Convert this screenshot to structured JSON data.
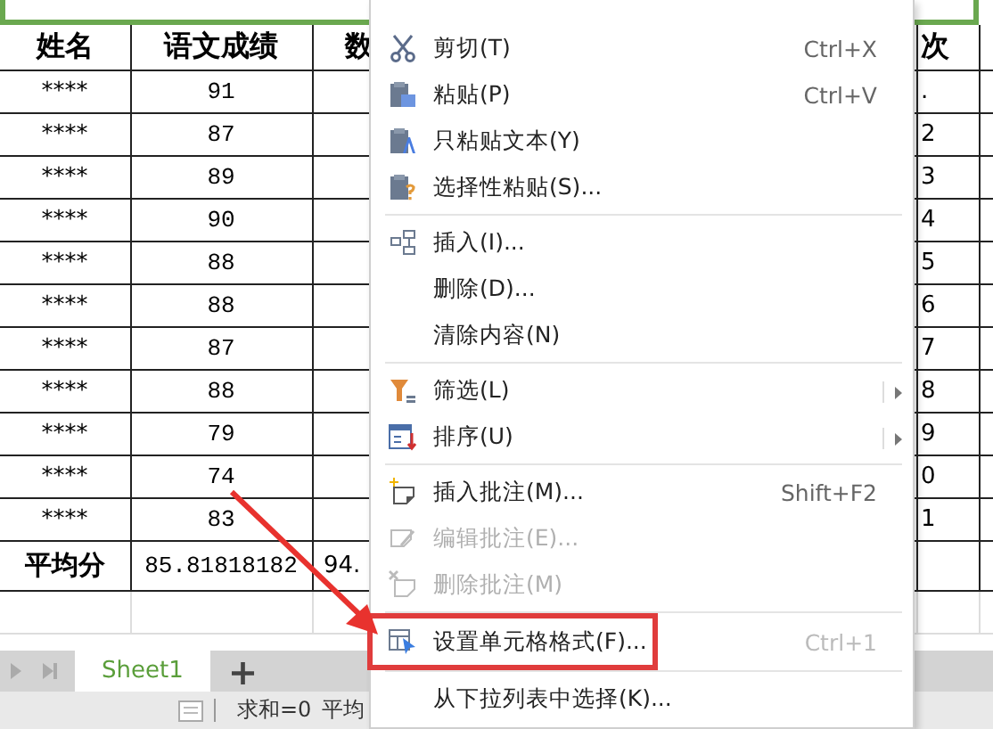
{
  "sheet": {
    "columns": [
      {
        "header": "姓名"
      },
      {
        "header": "语文成绩"
      },
      {
        "header": "数"
      },
      {
        "header": "次"
      }
    ],
    "rows": [
      {
        "cells": [
          "****",
          "91",
          "",
          "."
        ]
      },
      {
        "cells": [
          "****",
          "87",
          "",
          "2"
        ]
      },
      {
        "cells": [
          "****",
          "89",
          "",
          "3"
        ]
      },
      {
        "cells": [
          "****",
          "90",
          "",
          "4"
        ]
      },
      {
        "cells": [
          "****",
          "88",
          "",
          "5"
        ]
      },
      {
        "cells": [
          "****",
          "88",
          "",
          "6"
        ]
      },
      {
        "cells": [
          "****",
          "87",
          "",
          "7"
        ]
      },
      {
        "cells": [
          "****",
          "88",
          "",
          "8"
        ]
      },
      {
        "cells": [
          "****",
          "79",
          "",
          "9"
        ]
      },
      {
        "cells": [
          "****",
          "74",
          "",
          "0"
        ]
      },
      {
        "cells": [
          "****",
          "83",
          "",
          "1"
        ]
      }
    ],
    "average": {
      "cells": [
        "平均分",
        "85.81818182",
        "94.",
        ""
      ]
    }
  },
  "tabs": [
    {
      "label": "Sheet1",
      "selected": true
    }
  ],
  "add_tab": "+",
  "status_bar": {
    "sum": "求和=0",
    "average": "平均"
  },
  "context_menu": {
    "items": [
      {
        "kind": "item",
        "label": "剪切(T)",
        "shortcut": "Ctrl+X",
        "disabled": false,
        "submenu": false,
        "selected": false
      },
      {
        "kind": "item",
        "label": "粘贴(P)",
        "shortcut": "Ctrl+V",
        "disabled": false,
        "submenu": false,
        "selected": false
      },
      {
        "kind": "item",
        "label": "只粘贴文本(Y)",
        "disabled": false,
        "submenu": false,
        "selected": false
      },
      {
        "kind": "item",
        "label": "选择性粘贴(S)...",
        "disabled": false,
        "submenu": false,
        "selected": false
      },
      {
        "kind": "separator"
      },
      {
        "kind": "item",
        "label": "插入(I)...",
        "disabled": false,
        "submenu": false,
        "selected": false
      },
      {
        "kind": "item",
        "label": "删除(D)...",
        "disabled": false,
        "submenu": false,
        "selected": false
      },
      {
        "kind": "item",
        "label": "清除内容(N)",
        "disabled": false,
        "submenu": false,
        "selected": false
      },
      {
        "kind": "separator"
      },
      {
        "kind": "item",
        "label": "筛选(L)",
        "disabled": false,
        "submenu": true,
        "selected": false
      },
      {
        "kind": "item",
        "label": "排序(U)",
        "disabled": false,
        "submenu": true,
        "selected": false
      },
      {
        "kind": "separator"
      },
      {
        "kind": "item",
        "label": "插入批注(M)...",
        "shortcut": "Shift+F2",
        "disabled": false,
        "submenu": false,
        "selected": false
      },
      {
        "kind": "item",
        "label": "编辑批注(E)...",
        "disabled": true,
        "submenu": false,
        "selected": false
      },
      {
        "kind": "item",
        "label": "删除批注(M)",
        "disabled": true,
        "submenu": false,
        "selected": false
      },
      {
        "kind": "separator"
      },
      {
        "kind": "item",
        "label": "设置单元格格式(F)...",
        "shortcut": "Ctrl+1",
        "disabled": false,
        "submenu": false,
        "selected": true
      },
      {
        "kind": "separator"
      },
      {
        "kind": "item",
        "label": "从下拉列表中选择(K)...",
        "disabled": false,
        "submenu": false,
        "selected": false
      }
    ]
  }
}
